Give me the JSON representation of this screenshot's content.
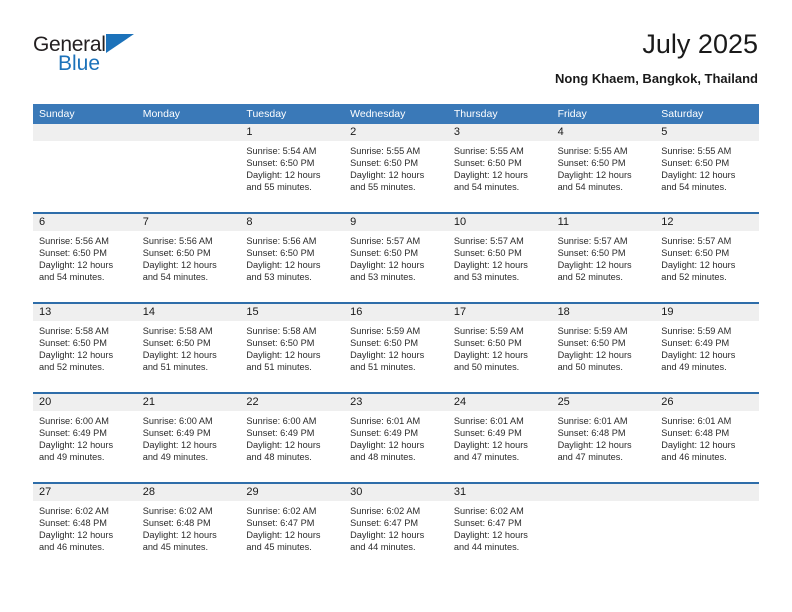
{
  "brand": {
    "name_top": "General",
    "name_bottom": "Blue",
    "triangle_color": "#1c72ba"
  },
  "header": {
    "title": "July 2025",
    "subtitle": "Nong Khaem, Bangkok, Thailand"
  },
  "theme": {
    "header_blue": "#3a79b8",
    "separator_blue": "#2e6da9",
    "daynum_band": "#efefef"
  },
  "weekdays": [
    "Sunday",
    "Monday",
    "Tuesday",
    "Wednesday",
    "Thursday",
    "Friday",
    "Saturday"
  ],
  "weeks": [
    [
      {
        "day": "",
        "lines": []
      },
      {
        "day": "",
        "lines": []
      },
      {
        "day": "1",
        "lines": [
          "Sunrise: 5:54 AM",
          "Sunset: 6:50 PM",
          "Daylight: 12 hours",
          "and 55 minutes."
        ]
      },
      {
        "day": "2",
        "lines": [
          "Sunrise: 5:55 AM",
          "Sunset: 6:50 PM",
          "Daylight: 12 hours",
          "and 55 minutes."
        ]
      },
      {
        "day": "3",
        "lines": [
          "Sunrise: 5:55 AM",
          "Sunset: 6:50 PM",
          "Daylight: 12 hours",
          "and 54 minutes."
        ]
      },
      {
        "day": "4",
        "lines": [
          "Sunrise: 5:55 AM",
          "Sunset: 6:50 PM",
          "Daylight: 12 hours",
          "and 54 minutes."
        ]
      },
      {
        "day": "5",
        "lines": [
          "Sunrise: 5:55 AM",
          "Sunset: 6:50 PM",
          "Daylight: 12 hours",
          "and 54 minutes."
        ]
      }
    ],
    [
      {
        "day": "6",
        "lines": [
          "Sunrise: 5:56 AM",
          "Sunset: 6:50 PM",
          "Daylight: 12 hours",
          "and 54 minutes."
        ]
      },
      {
        "day": "7",
        "lines": [
          "Sunrise: 5:56 AM",
          "Sunset: 6:50 PM",
          "Daylight: 12 hours",
          "and 54 minutes."
        ]
      },
      {
        "day": "8",
        "lines": [
          "Sunrise: 5:56 AM",
          "Sunset: 6:50 PM",
          "Daylight: 12 hours",
          "and 53 minutes."
        ]
      },
      {
        "day": "9",
        "lines": [
          "Sunrise: 5:57 AM",
          "Sunset: 6:50 PM",
          "Daylight: 12 hours",
          "and 53 minutes."
        ]
      },
      {
        "day": "10",
        "lines": [
          "Sunrise: 5:57 AM",
          "Sunset: 6:50 PM",
          "Daylight: 12 hours",
          "and 53 minutes."
        ]
      },
      {
        "day": "11",
        "lines": [
          "Sunrise: 5:57 AM",
          "Sunset: 6:50 PM",
          "Daylight: 12 hours",
          "and 52 minutes."
        ]
      },
      {
        "day": "12",
        "lines": [
          "Sunrise: 5:57 AM",
          "Sunset: 6:50 PM",
          "Daylight: 12 hours",
          "and 52 minutes."
        ]
      }
    ],
    [
      {
        "day": "13",
        "lines": [
          "Sunrise: 5:58 AM",
          "Sunset: 6:50 PM",
          "Daylight: 12 hours",
          "and 52 minutes."
        ]
      },
      {
        "day": "14",
        "lines": [
          "Sunrise: 5:58 AM",
          "Sunset: 6:50 PM",
          "Daylight: 12 hours",
          "and 51 minutes."
        ]
      },
      {
        "day": "15",
        "lines": [
          "Sunrise: 5:58 AM",
          "Sunset: 6:50 PM",
          "Daylight: 12 hours",
          "and 51 minutes."
        ]
      },
      {
        "day": "16",
        "lines": [
          "Sunrise: 5:59 AM",
          "Sunset: 6:50 PM",
          "Daylight: 12 hours",
          "and 51 minutes."
        ]
      },
      {
        "day": "17",
        "lines": [
          "Sunrise: 5:59 AM",
          "Sunset: 6:50 PM",
          "Daylight: 12 hours",
          "and 50 minutes."
        ]
      },
      {
        "day": "18",
        "lines": [
          "Sunrise: 5:59 AM",
          "Sunset: 6:50 PM",
          "Daylight: 12 hours",
          "and 50 minutes."
        ]
      },
      {
        "day": "19",
        "lines": [
          "Sunrise: 5:59 AM",
          "Sunset: 6:49 PM",
          "Daylight: 12 hours",
          "and 49 minutes."
        ]
      }
    ],
    [
      {
        "day": "20",
        "lines": [
          "Sunrise: 6:00 AM",
          "Sunset: 6:49 PM",
          "Daylight: 12 hours",
          "and 49 minutes."
        ]
      },
      {
        "day": "21",
        "lines": [
          "Sunrise: 6:00 AM",
          "Sunset: 6:49 PM",
          "Daylight: 12 hours",
          "and 49 minutes."
        ]
      },
      {
        "day": "22",
        "lines": [
          "Sunrise: 6:00 AM",
          "Sunset: 6:49 PM",
          "Daylight: 12 hours",
          "and 48 minutes."
        ]
      },
      {
        "day": "23",
        "lines": [
          "Sunrise: 6:01 AM",
          "Sunset: 6:49 PM",
          "Daylight: 12 hours",
          "and 48 minutes."
        ]
      },
      {
        "day": "24",
        "lines": [
          "Sunrise: 6:01 AM",
          "Sunset: 6:49 PM",
          "Daylight: 12 hours",
          "and 47 minutes."
        ]
      },
      {
        "day": "25",
        "lines": [
          "Sunrise: 6:01 AM",
          "Sunset: 6:48 PM",
          "Daylight: 12 hours",
          "and 47 minutes."
        ]
      },
      {
        "day": "26",
        "lines": [
          "Sunrise: 6:01 AM",
          "Sunset: 6:48 PM",
          "Daylight: 12 hours",
          "and 46 minutes."
        ]
      }
    ],
    [
      {
        "day": "27",
        "lines": [
          "Sunrise: 6:02 AM",
          "Sunset: 6:48 PM",
          "Daylight: 12 hours",
          "and 46 minutes."
        ]
      },
      {
        "day": "28",
        "lines": [
          "Sunrise: 6:02 AM",
          "Sunset: 6:48 PM",
          "Daylight: 12 hours",
          "and 45 minutes."
        ]
      },
      {
        "day": "29",
        "lines": [
          "Sunrise: 6:02 AM",
          "Sunset: 6:47 PM",
          "Daylight: 12 hours",
          "and 45 minutes."
        ]
      },
      {
        "day": "30",
        "lines": [
          "Sunrise: 6:02 AM",
          "Sunset: 6:47 PM",
          "Daylight: 12 hours",
          "and 44 minutes."
        ]
      },
      {
        "day": "31",
        "lines": [
          "Sunrise: 6:02 AM",
          "Sunset: 6:47 PM",
          "Daylight: 12 hours",
          "and 44 minutes."
        ]
      },
      {
        "day": "",
        "lines": []
      },
      {
        "day": "",
        "lines": []
      }
    ]
  ]
}
